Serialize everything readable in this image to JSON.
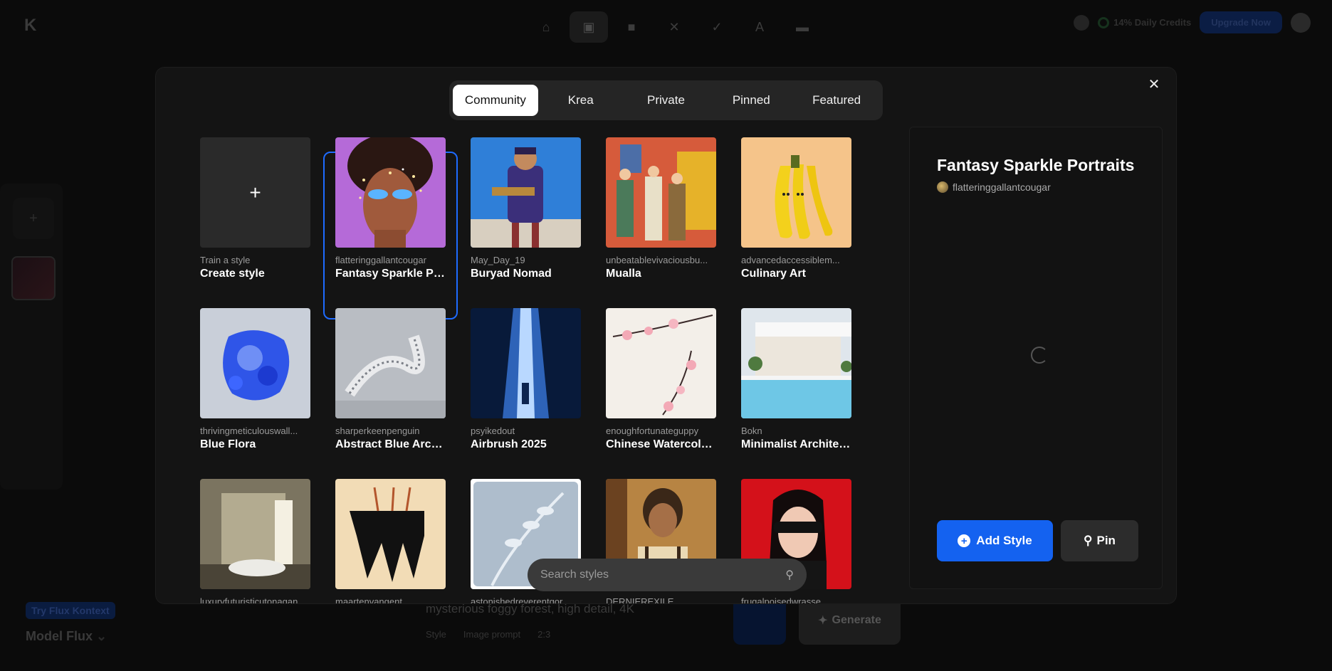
{
  "background": {
    "credits_text": "14% Daily Credits",
    "upgrade_label": "Upgrade Now",
    "try_badge": "Try Flux Kontext",
    "model_label": "Model",
    "model_value": "Flux",
    "prompt_text": "mysterious foggy forest, high detail, 4K",
    "chip_style": "Style",
    "chip_image_prompt": "Image prompt",
    "chip_ratio": "2:3",
    "generate_label": "Generate"
  },
  "modal": {
    "tabs": [
      "Community",
      "Krea",
      "Private",
      "Pinned",
      "Featured"
    ],
    "active_tab": "Community",
    "search_placeholder": "Search styles",
    "create_card": {
      "author": "Train a style",
      "title": "Create style"
    },
    "cards": [
      {
        "author": "flatteringgallantcougar",
        "title": "Fantasy Sparkle Po..."
      },
      {
        "author": "May_Day_19",
        "title": "Buryad Nomad"
      },
      {
        "author": "unbeatablevivaciousbu...",
        "title": "Mualla"
      },
      {
        "author": "advancedaccessiblem...",
        "title": "Culinary Art"
      },
      {
        "author": "thrivingmeticulouswall...",
        "title": "Blue Flora"
      },
      {
        "author": "sharperkeenpenguin",
        "title": "Abstract Blue Archi..."
      },
      {
        "author": "psyikedout",
        "title": "Airbrush 2025"
      },
      {
        "author": "enoughfortunateguppy",
        "title": "Chinese Watercolo..."
      },
      {
        "author": "Bokn",
        "title": "Minimalist Architec..."
      },
      {
        "author": "luxuryfuturisticutonagan",
        "title": ""
      },
      {
        "author": "maartenvangent",
        "title": ""
      },
      {
        "author": "astonishedreverentgor...",
        "title": ""
      },
      {
        "author": "DERNIEREXILE",
        "title": ""
      },
      {
        "author": "frugalpoisedwrasse",
        "title": ""
      }
    ],
    "detail": {
      "title": "Fantasy Sparkle Portraits",
      "author": "flatteringgallantcougar",
      "add_label": "Add Style",
      "pin_label": "Pin"
    }
  }
}
